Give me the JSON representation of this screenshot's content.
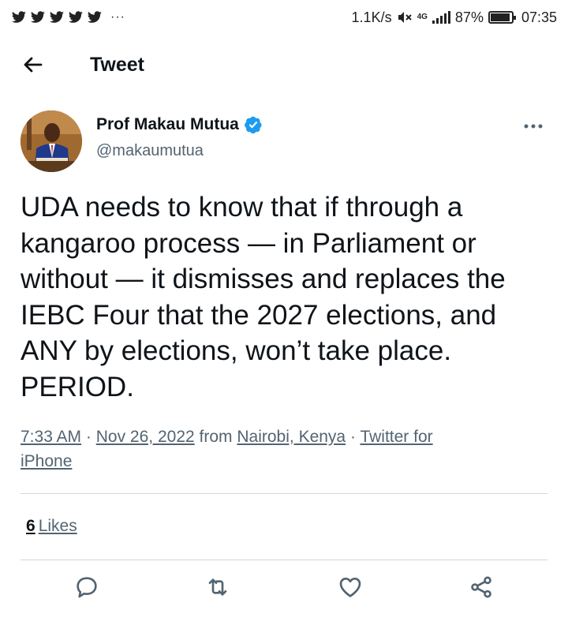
{
  "status_bar": {
    "notification_icons": [
      "twitter-icon",
      "twitter-icon",
      "twitter-icon",
      "twitter-icon",
      "twitter-icon"
    ],
    "more_indicator": "···",
    "network_speed": "1.1K/s",
    "network_type": "4G",
    "battery_percent": "87%",
    "battery_level": 0.87,
    "time": "07:35"
  },
  "header": {
    "title": "Tweet"
  },
  "tweet": {
    "author_name": "Prof Makau Mutua",
    "author_handle": "@makaumutua",
    "verified": true,
    "text": "UDA needs to know that if through a kangaroo process — in Parliament or without — it dismisses and replaces the IEBC Four that the 2027 elections, and ANY by elections, won’t take place. PERIOD.",
    "time": "7:33 AM",
    "separator": "·",
    "date": "Nov 26, 2022",
    "from_label": "from",
    "location": "Nairobi, Kenya",
    "source_part1": "Twitter for",
    "source_part2": "iPhone",
    "likes_count": "6",
    "likes_label": "Likes"
  },
  "colors": {
    "text_primary": "#0f1419",
    "text_secondary": "#536471",
    "verified_badge": "#1d9bf0",
    "divider": "#cfd9de"
  }
}
